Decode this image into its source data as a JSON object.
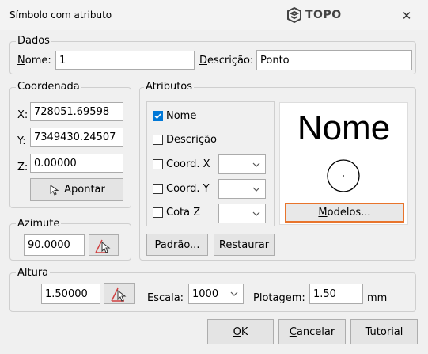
{
  "window": {
    "title": "Símbolo com atributo",
    "logo_text": "TOPO"
  },
  "dados": {
    "label": "Dados",
    "nome_label": "Nome:",
    "nome_value": "1",
    "descricao_label": "Descrição:",
    "descricao_value": "Ponto"
  },
  "coordenada": {
    "label": "Coordenada",
    "x_label": "X:",
    "x_value": "728051.69598",
    "y_label": "Y:",
    "y_value": "7349430.24507",
    "z_label": "Z:",
    "z_value": "0.00000",
    "apontar_label": "Apontar"
  },
  "azimute": {
    "label": "Azimute",
    "value": "90.0000"
  },
  "atributos": {
    "label": "Atributos",
    "items": [
      {
        "label": "Nome",
        "checked": true
      },
      {
        "label": "Descrição",
        "checked": false
      },
      {
        "label": "Coord. X",
        "checked": false,
        "combo": ""
      },
      {
        "label": "Coord. Y",
        "checked": false,
        "combo": ""
      },
      {
        "label": "Cota Z",
        "checked": false,
        "combo": ""
      }
    ],
    "preview_text": "Nome",
    "modelos_label": "Modelos...",
    "padrao_label": "Padrão...",
    "restaurar_label": "Restaurar"
  },
  "altura": {
    "label": "Altura",
    "value": "1.50000",
    "escala_label": "Escala:",
    "escala_value": "1000",
    "plotagem_label": "Plotagem:",
    "plotagem_value": "1.50",
    "unit": "mm"
  },
  "footer": {
    "ok_label": "OK",
    "cancelar_label": "Cancelar",
    "tutorial_label": "Tutorial"
  },
  "colors": {
    "accent": "#0078d7",
    "highlight_border": "#e8742c"
  }
}
